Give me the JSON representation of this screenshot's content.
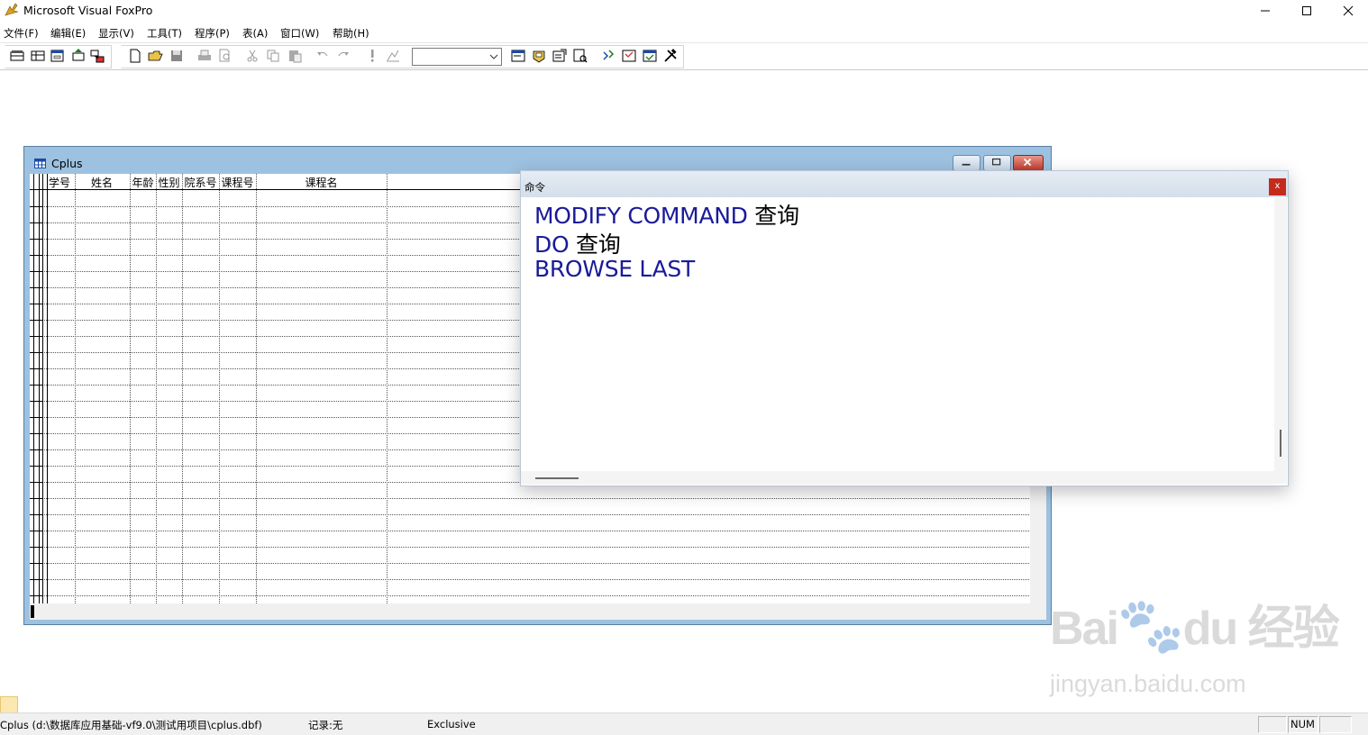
{
  "app": {
    "title": "Microsoft Visual FoxPro"
  },
  "menu": [
    "文件(F)",
    "编辑(E)",
    "显示(V)",
    "工具(T)",
    "程序(P)",
    "表(A)",
    "窗口(W)",
    "帮助(H)"
  ],
  "toolbar": {
    "combo_value": ""
  },
  "browse": {
    "title": "Cplus",
    "columns": [
      "学号",
      "姓名",
      "年龄",
      "性别",
      "院系号",
      "课程号",
      "课程名"
    ]
  },
  "command": {
    "title": "命令",
    "close_label": "x",
    "lines": [
      {
        "cmd": "MODIFY COMMAND",
        "arg": "查询"
      },
      {
        "cmd": "DO",
        "arg": "查询"
      },
      {
        "cmd": "BROWSE LAST",
        "arg": ""
      }
    ]
  },
  "status": {
    "path": "Cplus (d:\\数据库应用基础-vf9.0\\测试用项目\\cplus.dbf)",
    "record": "记录:无",
    "mode": "Exclusive",
    "num": "NUM"
  },
  "watermark": {
    "logo": "Baidu 经验",
    "url": "jingyan.baidu.com"
  }
}
